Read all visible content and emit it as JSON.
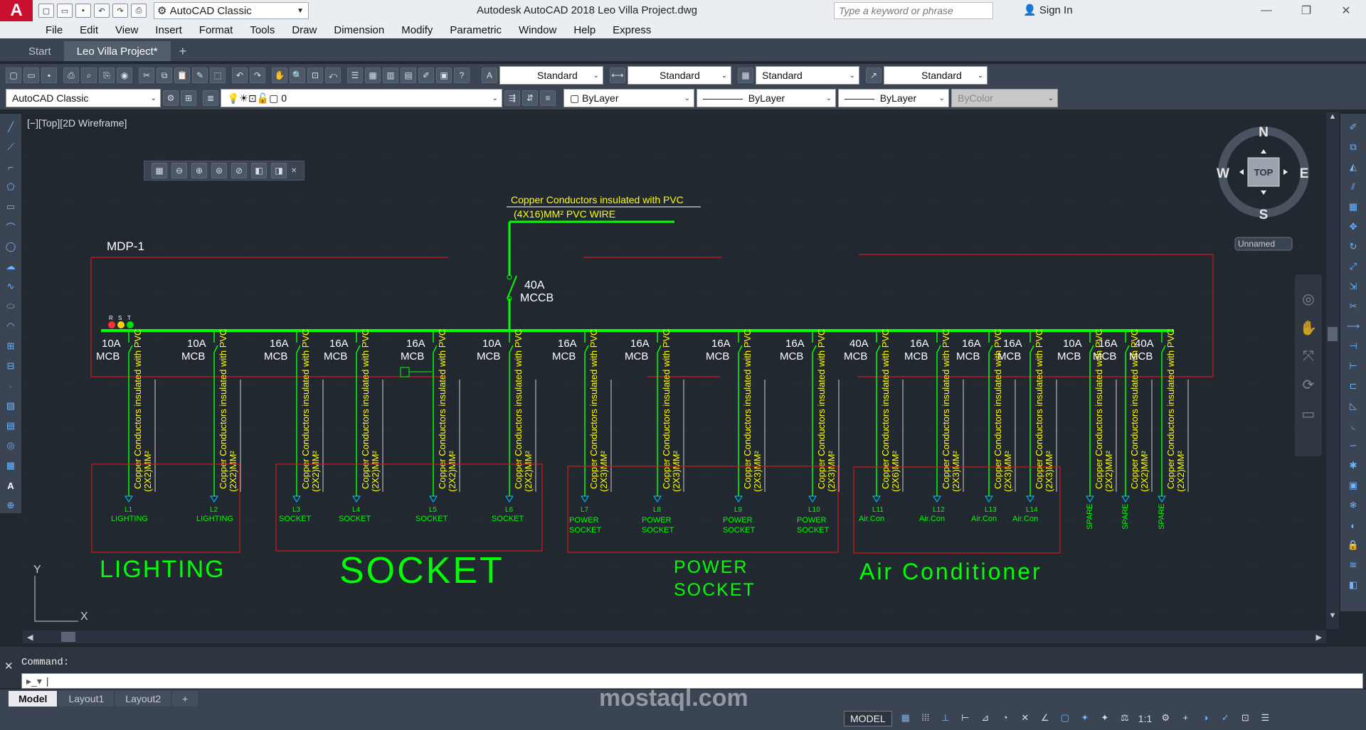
{
  "app": {
    "title": "Autodesk AutoCAD 2018    Leo Villa Project.dwg",
    "workspace": "AutoCAD Classic"
  },
  "search": {
    "placeholder": "Type a keyword or phrase"
  },
  "user": {
    "sign_in": "Sign In"
  },
  "menu": [
    "File",
    "Edit",
    "View",
    "Insert",
    "Format",
    "Tools",
    "Draw",
    "Dimension",
    "Modify",
    "Parametric",
    "Window",
    "Help",
    "Express"
  ],
  "doc_tabs": [
    {
      "label": "Start"
    },
    {
      "label": "Leo Villa Project*"
    }
  ],
  "styles": {
    "text_style": "Standard",
    "dim_style": "Standard",
    "table_style": "Standard",
    "mleader_style": "Standard"
  },
  "layers": {
    "workspace": "AutoCAD Classic",
    "current_layer": "0",
    "color": "ByLayer",
    "linetype": "ByLayer",
    "lineweight": "ByLayer",
    "plotstyle": "ByColor"
  },
  "viewport": {
    "label": "[−][Top][2D Wireframe]"
  },
  "viewcube": {
    "n": "N",
    "s": "S",
    "e": "E",
    "w": "W",
    "face": "TOP",
    "ucs": "Unnamed"
  },
  "drawing": {
    "panel_name": "MDP-1",
    "feeder_note_1": "Copper Conductors insulated with PVC",
    "feeder_note_2": "(4X16)MM² PVC WIRE",
    "main_breaker": {
      "rating": "40A",
      "type": "MCCB"
    },
    "phases": [
      "R",
      "S",
      "T"
    ],
    "cable_note": "Copper Conductors insulated with PVC",
    "circuits": [
      {
        "rating": "10A",
        "type": "MCB",
        "cable": "(2X2)MM²",
        "id": "L1",
        "load": "LIGHTING"
      },
      {
        "rating": "10A",
        "type": "MCB",
        "cable": "(2X2)MM²",
        "id": "L2",
        "load": "LIGHTING"
      },
      {
        "rating": "16A",
        "type": "MCB",
        "cable": "(2X2)MM²",
        "id": "L3",
        "load": "SOCKET"
      },
      {
        "rating": "16A",
        "type": "MCB",
        "cable": "(2X2)MM²",
        "id": "L4",
        "load": "SOCKET"
      },
      {
        "rating": "16A",
        "type": "MCB",
        "cable": "(2X2)MM²",
        "id": "L5",
        "load": "SOCKET"
      },
      {
        "rating": "10A",
        "type": "MCB",
        "cable": "(2X2)MM²",
        "id": "L6",
        "load": "SOCKET"
      },
      {
        "rating": "16A",
        "type": "MCB",
        "cable": "(2X3)MM²",
        "id": "L7",
        "load": "POWER SOCKET"
      },
      {
        "rating": "16A",
        "type": "MCB",
        "cable": "(2X3)MM²",
        "id": "L8",
        "load": "POWER SOCKET"
      },
      {
        "rating": "16A",
        "type": "MCB",
        "cable": "(2X3)MM²",
        "id": "L9",
        "load": "POWER SOCKET"
      },
      {
        "rating": "16A",
        "type": "MCB",
        "cable": "(2X3)MM²",
        "id": "L10",
        "load": "POWER SOCKET"
      },
      {
        "rating": "40A",
        "type": "MCB",
        "cable": "(2X6)MM²",
        "id": "L11",
        "load": "Air.Con"
      },
      {
        "rating": "16A",
        "type": "MCB",
        "cable": "(2X3)MM²",
        "id": "L12",
        "load": "Air.Con"
      },
      {
        "rating": "16A",
        "type": "MCB",
        "cable": "(2X3)MM²",
        "id": "L13",
        "load": "Air.Con"
      },
      {
        "rating": "16A",
        "type": "MCB",
        "cable": "(2X3)MM²",
        "id": "L14",
        "load": "Air.Con"
      },
      {
        "rating": "10A",
        "type": "MCB",
        "cable": "(2X2)MM²",
        "id": "",
        "load": "SPARE"
      },
      {
        "rating": "16A",
        "type": "MCB",
        "cable": "(2X2)MM²",
        "id": "",
        "load": "SPARE"
      },
      {
        "rating": "40A",
        "type": "MCB",
        "cable": "(2X2)MM²",
        "id": "",
        "load": "SPARE"
      }
    ],
    "groups": [
      {
        "label": "LIGHTING"
      },
      {
        "label": "SOCKET"
      },
      {
        "label": "POWER\nSOCKET"
      },
      {
        "label": "Air  Conditioner"
      }
    ],
    "ucs_x": "X",
    "ucs_y": "Y"
  },
  "command": {
    "label": "Command:"
  },
  "layout_tabs": [
    {
      "label": "Model"
    },
    {
      "label": "Layout1"
    },
    {
      "label": "Layout2"
    }
  ],
  "statusbar": {
    "mode": "MODEL",
    "scale": "1:1"
  },
  "watermark": "mostaql.com",
  "colors": {
    "wire": "#00ff00",
    "panel": "#d01818",
    "text_yellow": "#ffff00",
    "cyan": "#00c8ff"
  }
}
